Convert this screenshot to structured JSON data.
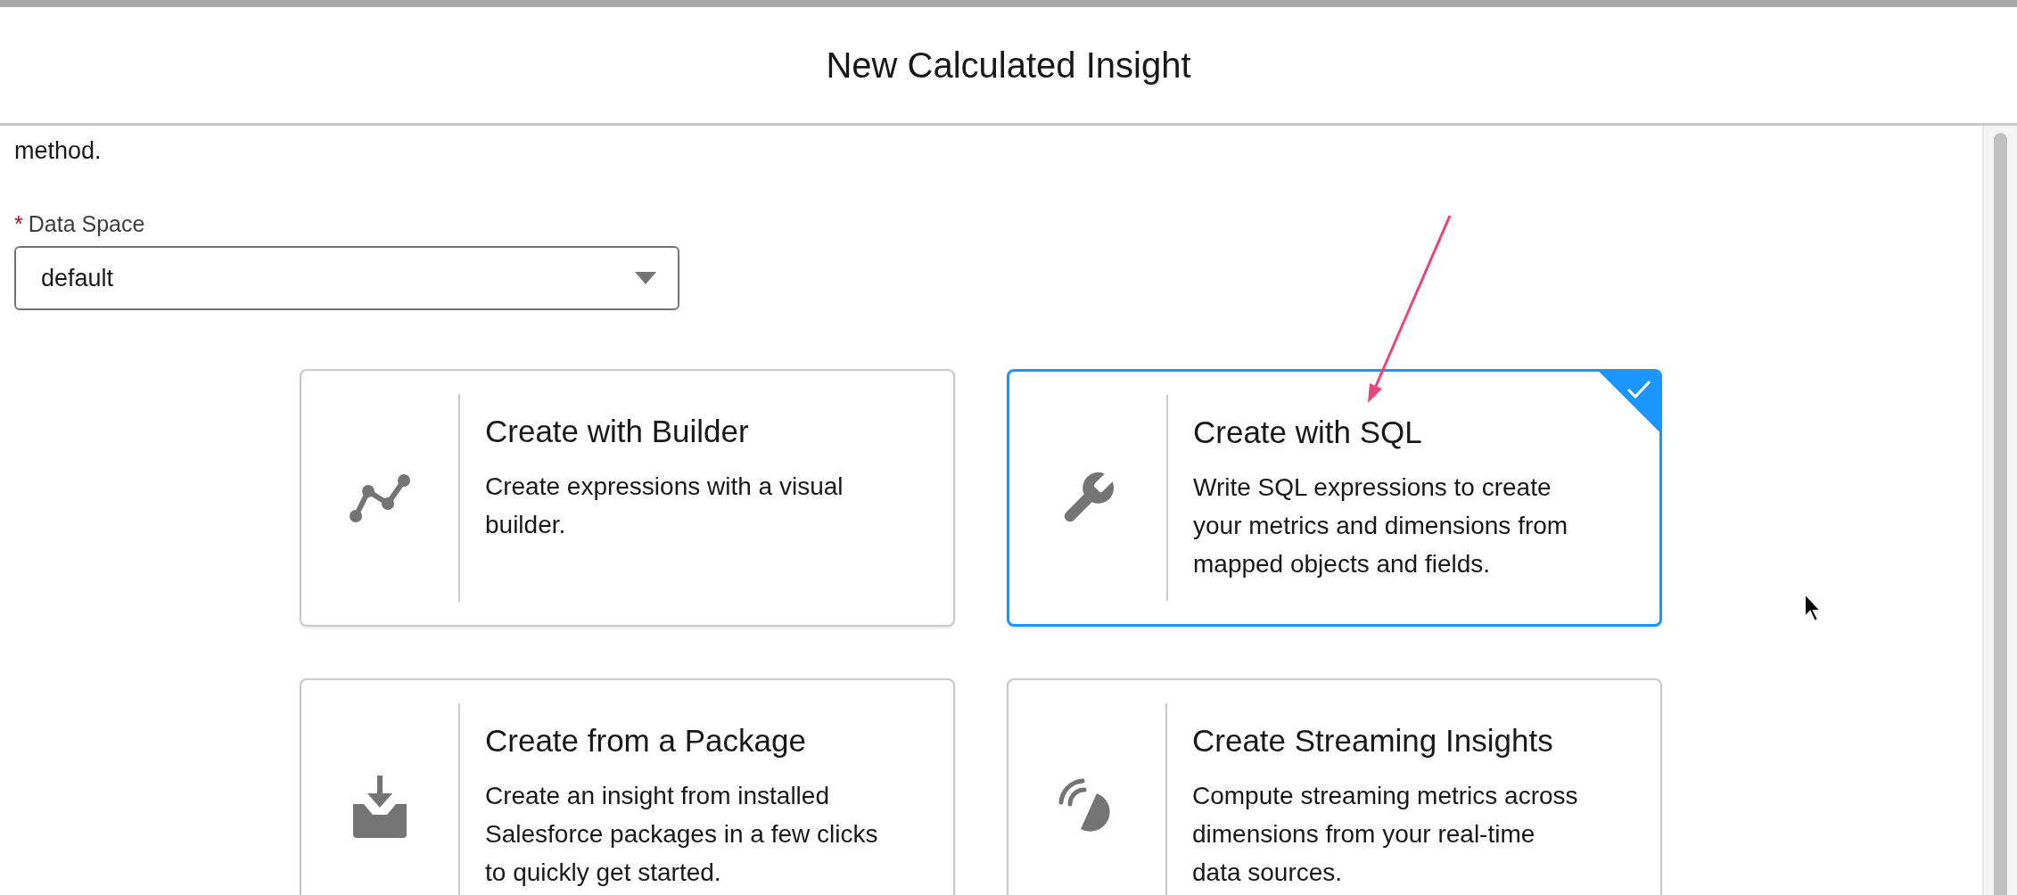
{
  "modal": {
    "title": "New Calculated Insight"
  },
  "intro_text": "method.",
  "data_space": {
    "label": "Data Space",
    "required_marker": "*",
    "value": "default"
  },
  "options": [
    {
      "kind": "builder",
      "title": "Create with Builder",
      "description": "Create expressions with a visual builder.",
      "selected": false
    },
    {
      "kind": "sql",
      "title": "Create with SQL",
      "description": "Write SQL expressions to create your metrics and dimensions from mapped objects and fields.",
      "selected": true
    },
    {
      "kind": "package",
      "title": "Create from a Package",
      "description": "Create an insight from installed Salesforce packages in a few clicks to quickly get started.",
      "selected": false
    },
    {
      "kind": "streaming",
      "title": "Create Streaming Insights",
      "description": "Compute streaming metrics across dimensions from your real-time data sources.",
      "selected": false
    }
  ]
}
